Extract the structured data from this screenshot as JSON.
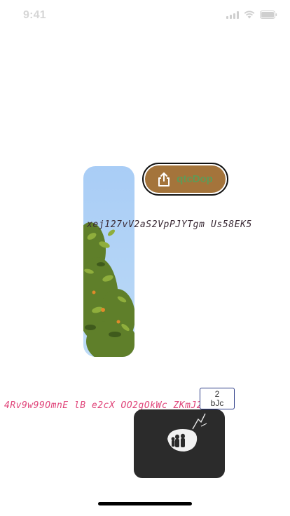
{
  "status_bar": {
    "time": "9:41",
    "icons": [
      "signal-icon",
      "wifi-icon",
      "battery-icon"
    ]
  },
  "share_button": {
    "label": "qtcDop",
    "icon": "share-icon",
    "colors": {
      "fill": "#a4743b",
      "label": "#5f9a57",
      "border": "#111111"
    }
  },
  "text_line_1": "xej127vV2aS2VpPJYTgm Us58EK5",
  "text_line_2": "4Rv9w99OmnE lB e2cX OO2gOkWc  ZKmJ2cY",
  "badge": {
    "count": "2",
    "label": "bJc"
  },
  "colors": {
    "accent_pink": "#e0457a",
    "dark_card": "#2b2b2b"
  }
}
